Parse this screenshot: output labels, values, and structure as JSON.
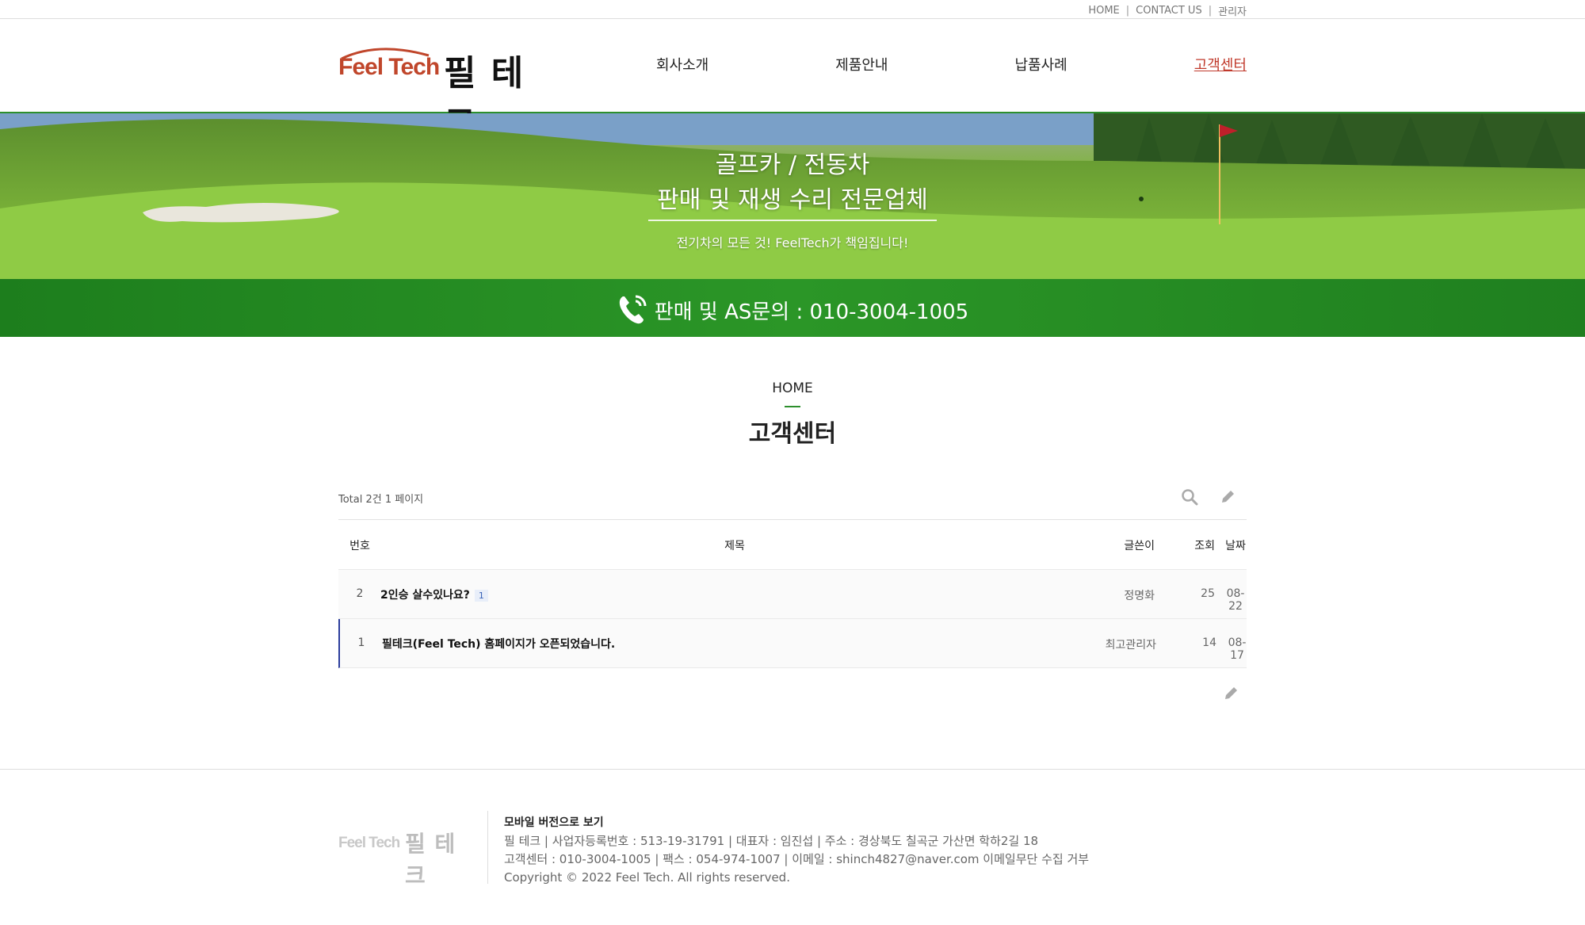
{
  "topbar": {
    "links": [
      "HOME",
      "CONTACT US",
      "관리자"
    ]
  },
  "header": {
    "logo_en": "Feel Tech",
    "logo_ko": "필 테크",
    "nav": [
      "회사소개",
      "제품안내",
      "납품사례",
      "고객센터"
    ],
    "active_nav": "고객센터"
  },
  "banner": {
    "title_line1": "골프카 / 전동차",
    "title_line2": "판매 및 재생 수리 전문업체",
    "subtitle": "전기차의 모든 것! FeelTech가 책임집니다!",
    "call_text": "판매 및 AS문의 : 010-3004-1005"
  },
  "page": {
    "breadcrumb": "HOME",
    "title": "고객센터"
  },
  "board": {
    "info": "Total 2건 1 페이지",
    "icons": [
      "search-icon",
      "pencil-icon"
    ],
    "columns": {
      "num": "번호",
      "title": "제목",
      "writer": "글쓴이",
      "hits": "조회",
      "date": "날짜"
    },
    "rows": [
      {
        "num": "2",
        "title": "2인승 살수있나요?",
        "comments": "1",
        "writer": "정명화",
        "hits": "25",
        "date": "08-22"
      },
      {
        "num": "1",
        "title": "필테크(Feel Tech) 홈페이지가 오픈되었습니다.",
        "comments": "",
        "writer": "최고관리자",
        "hits": "14",
        "date": "08-17"
      }
    ]
  },
  "footer": {
    "logo_en": "Feel Tech",
    "logo_ko": "필 테크",
    "mobile_link": "모바일 버전으로 보기",
    "line1": "필 테크  |  사업자등록번호 : 513-19-31791  |  대표자 : 임진섭  |  주소 : 경상북도 칠곡군 가산면 학하2길 18",
    "line2": "고객센터 : 010-3004-1005  |  팩스 : 054-974-1007  |  이메일 : shinch4827@naver.com 이메일무단 수집 거부",
    "copyright": "Copyright © 2022 Feel Tech. All rights reserved."
  },
  "colors": {
    "brand_green": "#2d8f2d",
    "active_nav": "#c0392b",
    "logo_red": "#c0462b"
  }
}
